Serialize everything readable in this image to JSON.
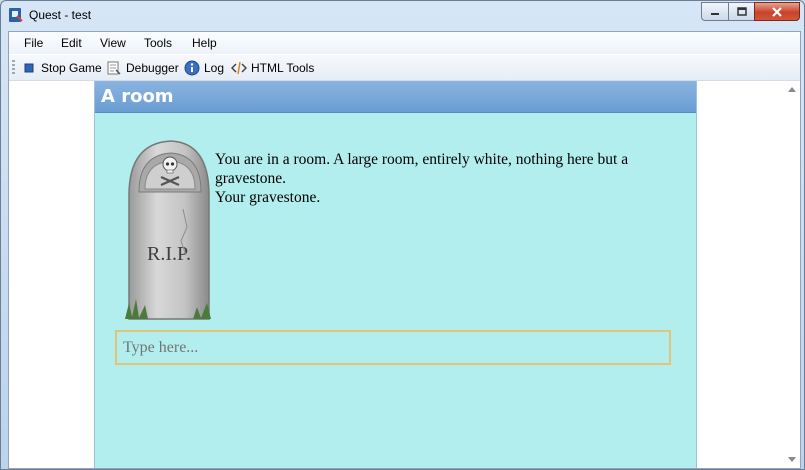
{
  "window": {
    "title": "Quest - test"
  },
  "menu": [
    "File",
    "Edit",
    "View",
    "Tools",
    "Help"
  ],
  "toolbar": {
    "stop_game": "Stop Game",
    "debugger": "Debugger",
    "log": "Log",
    "html_tools": "HTML Tools"
  },
  "room": {
    "title": "A room",
    "description_1": "You are in a room. A large room, entirely white, nothing here but a gravestone.",
    "description_2": "Your gravestone.",
    "image_text": "R.I.P.",
    "command_placeholder": "Type here..."
  },
  "colors": {
    "room_background": "#b2eeee",
    "header_background": "#6a9dd3",
    "input_border": "#e2c478"
  }
}
